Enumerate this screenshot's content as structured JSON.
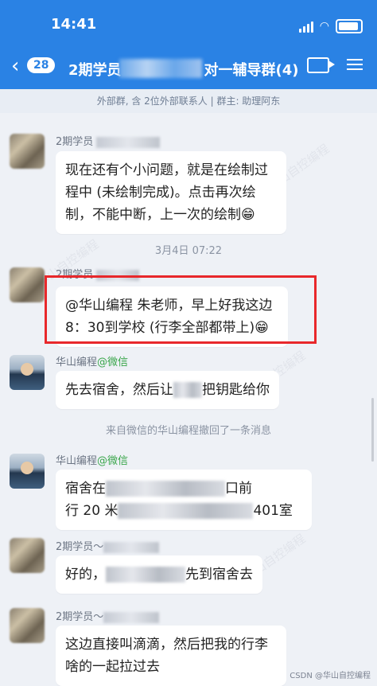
{
  "status_bar": {
    "time": "14:41"
  },
  "header": {
    "back_count": "28",
    "title_start": "2期学员",
    "title_end": "对一辅导群(4)",
    "subtitle": "外部群, 含 2位外部联系人 | 群主: 助理阿东"
  },
  "messages": [
    {
      "sender": "2期学员",
      "text": "现在还有个小问题，就是在绘制过程中 (未绘制完成)。点击再次绘制，不能中断，上一次的绘制😁"
    },
    {
      "sender": "2期学员",
      "text": "@华山编程 朱老师，早上好我这边8：30到学校 (行李全部都带上)😁"
    },
    {
      "sender": "华山编程",
      "sender_tag": "@微信",
      "text_start": "先去宿舍，然后让",
      "text_end": "把钥匙给你"
    },
    {
      "sender": "华山编程",
      "sender_tag": "@微信",
      "line1_start": "宿舍在",
      "line1_end": "口前",
      "line2_start": "行 20 米",
      "line2_end": "401室"
    },
    {
      "sender": "2期学员～",
      "text_start": "好的，",
      "text_end": "先到宿舍去"
    },
    {
      "sender": "2期学员～",
      "text": "这边直接叫滴滴，然后把我的行李啥的一起拉过去"
    }
  ],
  "timestamp": "3月4日 07:22",
  "system_message": "来自微信的华山编程撤回了一条消息",
  "watermark_text": "华山自控编程",
  "footer": "CSDN @华山自控编程",
  "colors": {
    "header_bg": "#2a82e4",
    "chat_bg": "#eef1f6",
    "highlight_border": "#e8282b",
    "wechat_tag": "#3aa64b"
  }
}
